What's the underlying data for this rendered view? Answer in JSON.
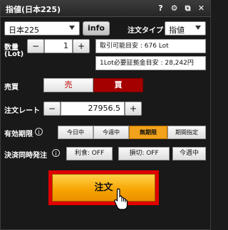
{
  "title": "指値(日本225)",
  "titlebar_icons": [
    "help-icon",
    "gear-icon",
    "popout-icon",
    "close-icon"
  ],
  "titlebar_glyphs": [
    "?",
    "⚙",
    "⧉",
    "✕"
  ],
  "symbol": {
    "value": "日本225"
  },
  "info_label": "info",
  "order_type": {
    "label": "注文タイプ",
    "value": "指値"
  },
  "quantity": {
    "label_line1": "数量",
    "label_line2": "(Lot)",
    "minus": "−",
    "value": "1",
    "plus": "+",
    "tradable": "取引可能目安 : 676 Lot",
    "margin": "1Lot必要証拠金目安 : 28,242円"
  },
  "side": {
    "label": "売買",
    "sell": "売",
    "buy": "買",
    "selected": "buy"
  },
  "rate": {
    "label": "注文レート",
    "minus": "−",
    "value": "27956.5",
    "plus": "+"
  },
  "expiry": {
    "label": "有効期限",
    "info_glyph": "i",
    "options": [
      "今日中",
      "今週中",
      "無期限",
      "期間指定"
    ],
    "selected": "無期限"
  },
  "settlement": {
    "label": "決済同時発注",
    "info_glyph": "i",
    "take_profit": "利食: OFF",
    "stop_loss": "損切: OFF",
    "this_week": "今週中"
  },
  "order_button": "注文",
  "colors": {
    "accent_orange": "#f6a300",
    "buy_red": "#a40000",
    "highlight_red": "#e00000",
    "sell_text": "#c00000"
  }
}
